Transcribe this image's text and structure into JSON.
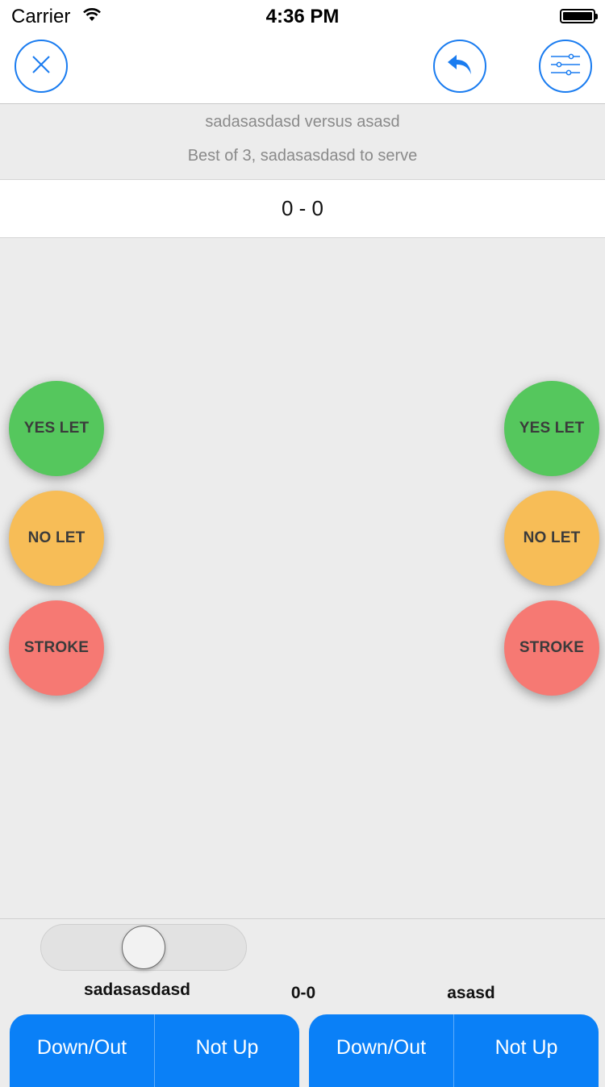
{
  "status_bar": {
    "carrier": "Carrier",
    "time": "4:36 PM"
  },
  "nav": {
    "close_icon": "close-icon",
    "undo_icon": "undo-icon",
    "settings_icon": "sliders-icon",
    "accent_color": "#1a7cf0"
  },
  "match": {
    "title": "sadasasdasd versus asasd",
    "subtitle": "Best of 3, sadasasdasd to serve",
    "games_score": "0 - 0"
  },
  "decisions": {
    "left": {
      "yes_let": "YES LET",
      "no_let": "NO LET",
      "stroke": "STROKE"
    },
    "right": {
      "yes_let": "YES LET",
      "no_let": "NO LET",
      "stroke": "STROKE"
    },
    "colors": {
      "yes_let": "#55c75d",
      "no_let": "#f7bd57",
      "stroke": "#f67973"
    }
  },
  "players": {
    "left_name": "sadasasdasd",
    "right_name": "asasd",
    "game_score": "0-0"
  },
  "actions": {
    "left": {
      "down_out": "Down/Out",
      "not_up": "Not Up"
    },
    "right": {
      "down_out": "Down/Out",
      "not_up": "Not Up"
    },
    "button_color": "#0a80f7"
  }
}
